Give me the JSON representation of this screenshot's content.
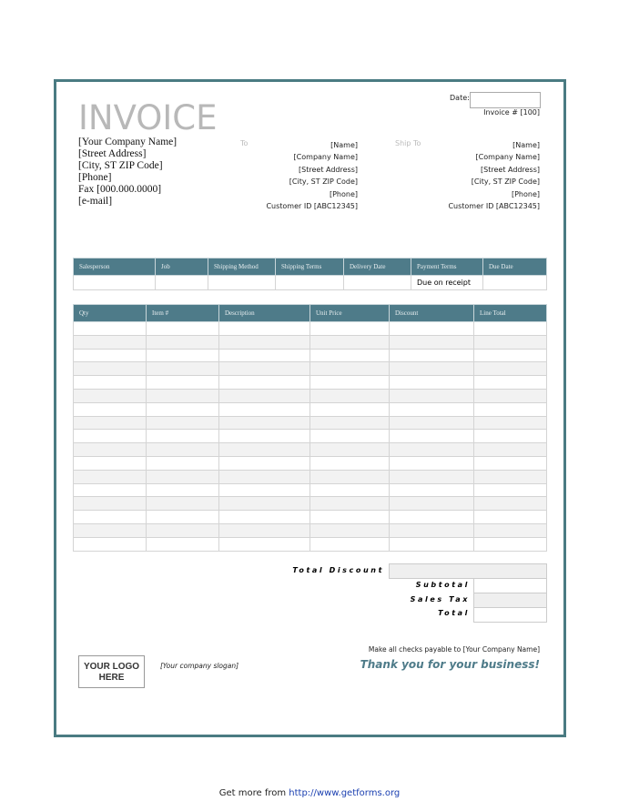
{
  "title": "INVOICE",
  "date_label": "Date:",
  "invoice_number": "Invoice # [100]",
  "company": [
    "[Your Company Name]",
    "[Street Address]",
    "[City, ST  ZIP Code]",
    "[Phone]",
    "Fax [000.000.0000]",
    "[e-mail]"
  ],
  "to": {
    "label": "To",
    "lines": [
      "[Name]",
      "[Company Name]",
      "[Street Address]",
      "[City, ST  ZIP Code]",
      "[Phone]",
      "Customer ID [ABC12345]"
    ]
  },
  "ship_to": {
    "label": "Ship To",
    "lines": [
      "[Name]",
      "[Company Name]",
      "[Street Address]",
      "[City, ST  ZIP Code]",
      "[Phone]",
      "Customer ID [ABC12345]"
    ]
  },
  "info_table": {
    "headers": [
      "Salesperson",
      "Job",
      "Shipping Method",
      "Shipping Terms",
      "Delivery Date",
      "Payment Terms",
      "Due Date"
    ],
    "row": [
      "",
      "",
      "",
      "",
      "",
      "Due on receipt",
      ""
    ]
  },
  "items_table": {
    "headers": [
      "Qty",
      "Item #",
      "Description",
      "Unit Price",
      "Discount",
      "Line Total"
    ]
  },
  "totals": {
    "total_discount": "Total Discount",
    "subtotal": "Subtotal",
    "sales_tax": "Sales Tax",
    "total": "Total"
  },
  "checks_payable": "Make all checks payable to [Your Company Name]",
  "thanks": "Thank you for your business!",
  "logo": "YOUR LOGO HERE",
  "slogan": "[Your company slogan]",
  "footer": {
    "prefix": "Get more from ",
    "link": "http://www.getforms.org"
  },
  "colors": {
    "header": "#4e7b89",
    "frame": "#4a7b82",
    "thanks": "#4e7b89"
  }
}
